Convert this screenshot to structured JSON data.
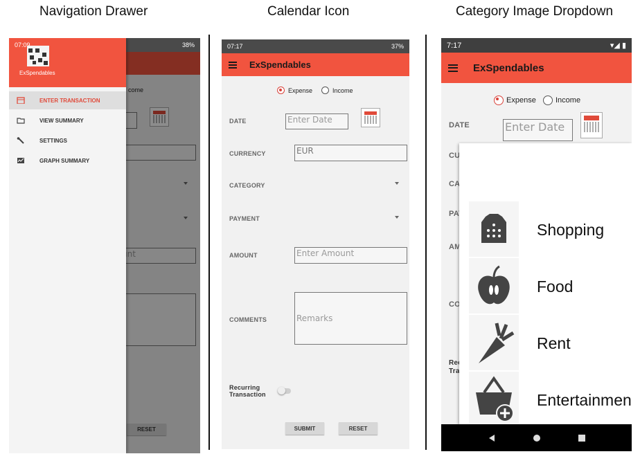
{
  "captions": [
    "Navigation Drawer",
    "Calendar Icon",
    "Category Image Dropdown"
  ],
  "app_title": "ExSpendables",
  "phone1": {
    "status_time": "07:09",
    "status_right": "38%",
    "drawer_title": "ExSpendables",
    "menu": [
      "ENTER TRANSACTION",
      "VIEW SUMMARY",
      "SETTINGS",
      "GRAPH SUMMARY"
    ],
    "peek_income": "come",
    "peek_amount": "unt",
    "reset": "RESET"
  },
  "phone2": {
    "status_time": "07:17",
    "status_right": "37%",
    "expense": "Expense",
    "income": "Income",
    "labels": {
      "date": "DATE",
      "currency": "CURRENCY",
      "category": "CATEGORY",
      "payment": "PAYMENT",
      "amount": "AMOUNT",
      "comments": "COMMENTS",
      "recurring": "Recurring Transaction"
    },
    "date_placeholder": "Enter Date",
    "currency_value": "EUR",
    "amount_placeholder": "Enter Amount",
    "comments_placeholder": "Remarks",
    "submit": "SUBMIT",
    "reset": "RESET"
  },
  "phone3": {
    "status_time": "7:17",
    "expense": "Expense",
    "income": "Income",
    "label_date": "DATE",
    "label_peeks": [
      "CUR",
      "CAT",
      "PAY",
      "AM",
      "CO",
      "Rec",
      "Tra"
    ],
    "date_placeholder": "Enter Date",
    "categories": [
      "Shopping",
      "Food",
      "Rent",
      "Entertainment"
    ]
  },
  "colors": {
    "accent": "#f1543f",
    "status": "#4a4a4a"
  }
}
